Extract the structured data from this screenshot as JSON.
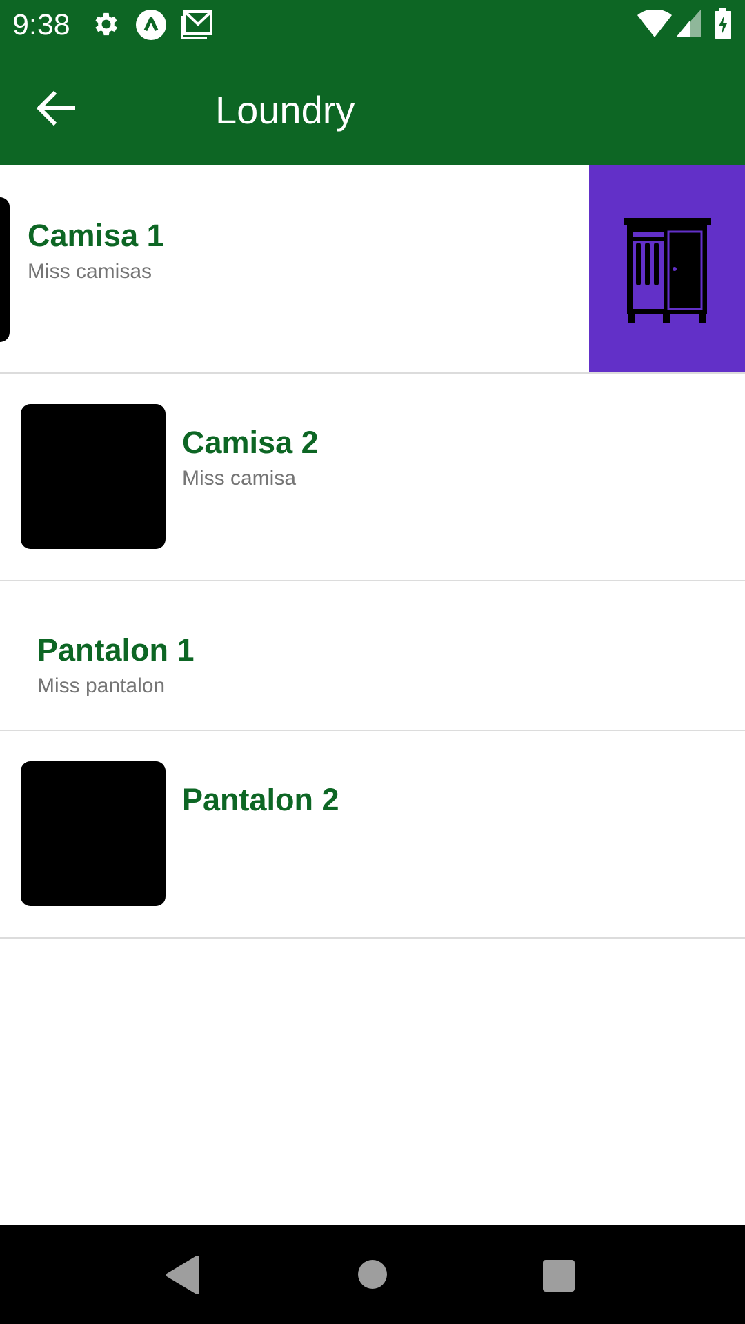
{
  "status_bar": {
    "time": "9:38",
    "icons_left": [
      "gear-icon",
      "app-a-icon",
      "gmail-icon"
    ],
    "icons_right": [
      "wifi-icon",
      "signal-icon",
      "battery-charging-icon"
    ],
    "background": "#0d6624"
  },
  "app_bar": {
    "title": "Loundry",
    "back_icon": "arrow-left-icon",
    "background": "#0d6624"
  },
  "items": [
    {
      "title": "Camisa 1",
      "subtitle": "Miss camisas",
      "has_image": true,
      "swiped": true,
      "action_icon": "wardrobe-icon",
      "action_color": "#6230c8"
    },
    {
      "title": "Camisa 2",
      "subtitle": "Miss camisa",
      "has_image": true
    },
    {
      "title": "Pantalon 1",
      "subtitle": "Miss pantalon",
      "has_image": false
    },
    {
      "title": "Pantalon 2",
      "subtitle": "",
      "has_image": true
    }
  ],
  "nav_bar": {
    "buttons": [
      "back-triangle-icon",
      "home-circle-icon",
      "recents-square-icon"
    ]
  },
  "colors": {
    "title_green": "#0d6624",
    "subtitle_gray": "#757575",
    "divider": "#dcdcdc"
  }
}
